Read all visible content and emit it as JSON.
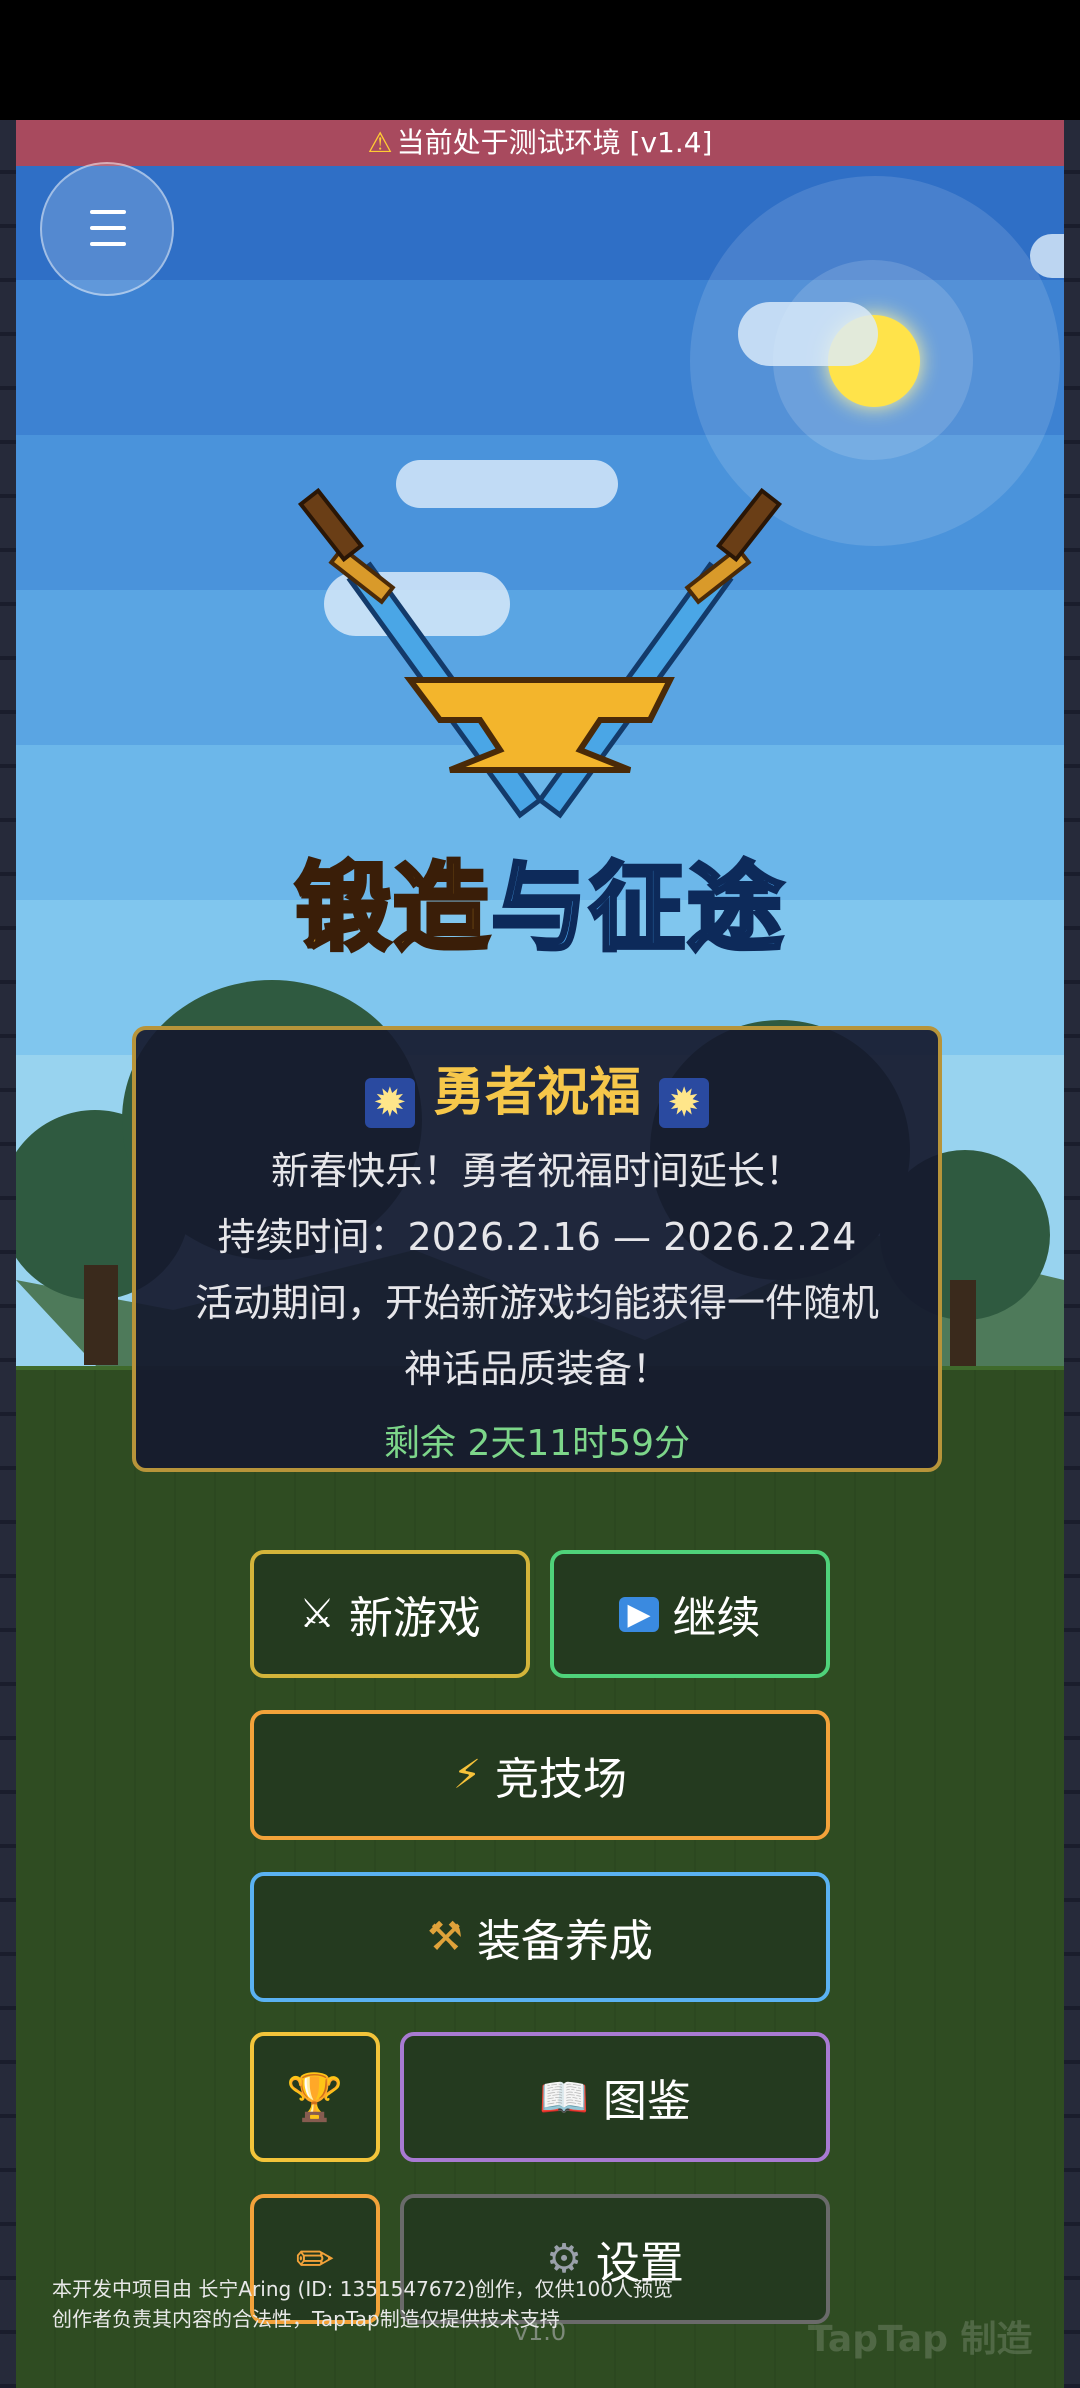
{
  "banner": {
    "text": "当前处于测试环境 [v1.4]"
  },
  "logo": {
    "part1": "锻造",
    "part2": "与征途"
  },
  "event": {
    "title": "勇者祝福",
    "star_icon": "✹",
    "line1": "新春快乐！勇者祝福时间延长！",
    "line2": "持续时间：2026.2.16 — 2026.2.24",
    "line3": "活动期间，开始新游戏均能获得一件随机",
    "line4": "神话品质装备！",
    "remaining": "剩余 2天11时59分"
  },
  "buttons": {
    "new_game": {
      "label": "新游戏",
      "icon": "⚔",
      "border": "#d3b43a"
    },
    "continue": {
      "label": "继续",
      "icon": "▶",
      "border": "#4fd27a"
    },
    "arena": {
      "label": "竞技场",
      "icon": "⚡",
      "border": "#f2a23a"
    },
    "equipment": {
      "label": "装备养成",
      "icon": "⚒",
      "border": "#5ab2f2"
    },
    "trophy": {
      "icon": "🏆",
      "border": "#f2c43a"
    },
    "codex": {
      "label": "图鉴",
      "icon": "📖",
      "border": "#a87ad2"
    },
    "edit": {
      "icon": "✏",
      "border": "#f2a23a"
    },
    "settings": {
      "label": "设置",
      "icon": "⚙",
      "border": "#6a6a6a"
    }
  },
  "footer": {
    "line1": "本开发中项目由 长宁Aring (ID: 1351547672)创作，仅供100人预览",
    "line2": "创作者负责其内容的合法性，TapTap制造仅提供技术支持",
    "version": "v1.0",
    "brand": "TapTap 制造"
  }
}
